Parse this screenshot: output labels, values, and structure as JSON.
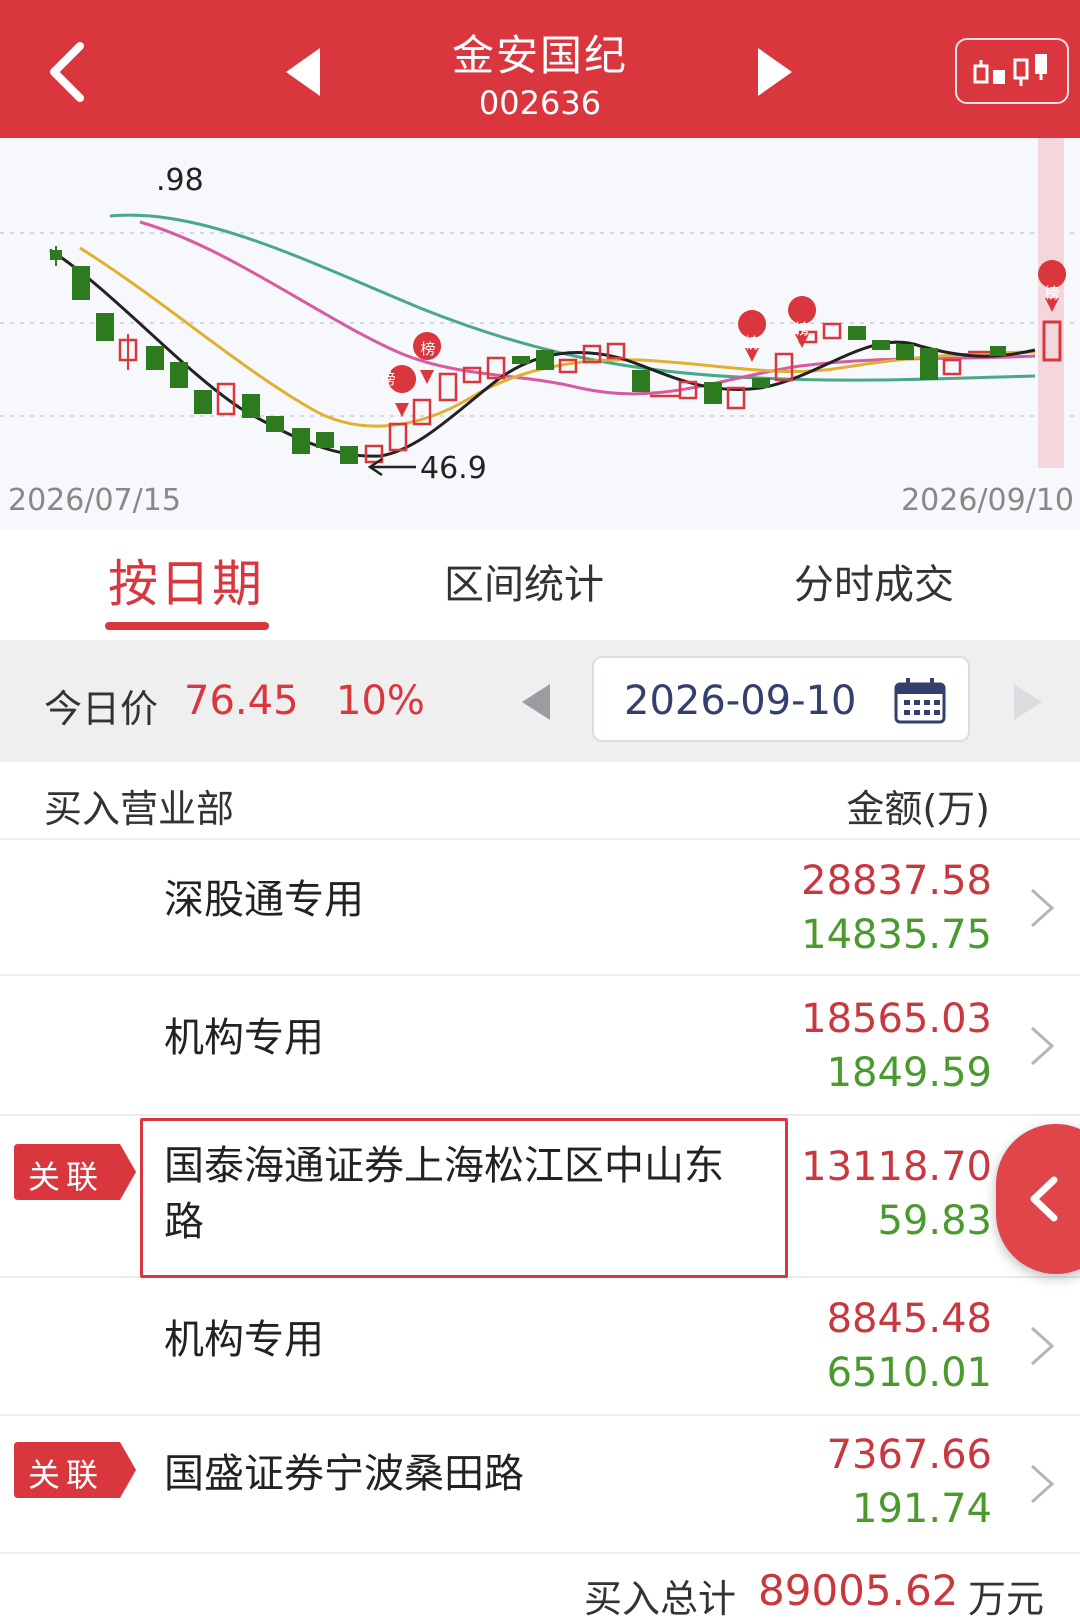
{
  "header": {
    "title": "金安国纪",
    "code": "002636"
  },
  "chart": {
    "start_date": "2026/07/15",
    "end_date": "2026/09/10",
    "high_label": ".98",
    "low_label": "46.9",
    "marker_label": "榜"
  },
  "chart_data": {
    "type": "candlestick",
    "x_range": [
      "2026/07/15",
      "2026/09/10"
    ],
    "annotations": [
      ".98",
      "46.9"
    ],
    "up_color": "#d9363e",
    "down_color": "#2e7a1e",
    "ma_colors": [
      "#222222",
      "#e0b030",
      "#d85aa0",
      "#4aa888"
    ]
  },
  "tabs": [
    {
      "label": "按日期",
      "active": true
    },
    {
      "label": "区间统计",
      "active": false
    },
    {
      "label": "分时成交",
      "active": false
    }
  ],
  "pricebar": {
    "label": "今日价",
    "price": "76.45",
    "change": "10%",
    "date": "2026-09-10"
  },
  "table": {
    "col_left": "买入营业部",
    "col_right": "金额(万)",
    "rows": [
      {
        "name": "深股通专用",
        "buy": "28837.58",
        "sell": "14835.75",
        "badge": ""
      },
      {
        "name": "机构专用",
        "buy": "18565.03",
        "sell": "1849.59",
        "badge": ""
      },
      {
        "name": "国泰海通证券上海松江区中山东",
        "name2": "路",
        "buy": "13118.70",
        "sell": "59.83",
        "badge": "关联"
      },
      {
        "name": "机构专用",
        "buy": "8845.48",
        "sell": "6510.01",
        "badge": ""
      },
      {
        "name": "国盛证券宁波桑田路",
        "buy": "7367.66",
        "sell": "191.74",
        "badge": "关联"
      }
    ]
  },
  "total": {
    "label": "买入总计",
    "value": "89005.62",
    "unit": "万元"
  },
  "colors": {
    "brand": "#d9363e",
    "up": "#c8383e",
    "down": "#4a9a2e"
  }
}
